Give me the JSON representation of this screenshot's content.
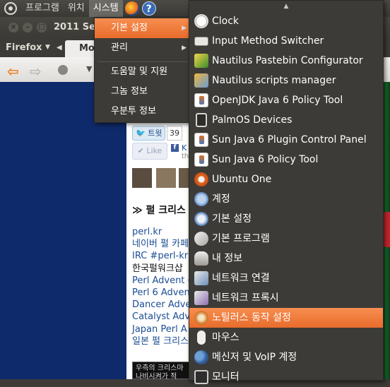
{
  "panel": {
    "menus": [
      "프로그램",
      "위치",
      "시스템"
    ],
    "active_menu": "시스템"
  },
  "browser": {
    "title": "2011 Se",
    "app_menu": "Firefox",
    "tab_label": "Mo",
    "tweet_label": "트윗",
    "tweet_count": "39",
    "like_label": "Like",
    "fb_name_frag": "K",
    "fb_sub_frag": "th",
    "section_title": "≫ 펄 크리스",
    "links": [
      "perl.kr",
      "네이버 펄 카페",
      "IRC #perl-kr",
      "한국펄워크샵",
      "Perl Advent (",
      "Perl 6 Adven",
      "Dancer Adve",
      "Catalyst Adv",
      "Japan Perl A",
      "일본 펄 크리스"
    ],
    "note_text": "우측의 크리스마 나비시켜가 적"
  },
  "system_menu": {
    "items": [
      {
        "label": "기본 설정",
        "has_submenu": true,
        "highlighted": true
      },
      {
        "label": "관리",
        "has_submenu": true,
        "highlighted": false
      },
      {
        "label": "도움말 및 지원",
        "has_submenu": false,
        "highlighted": false
      },
      {
        "label": "그놈 정보",
        "has_submenu": false,
        "highlighted": false
      },
      {
        "label": "우분투 정보",
        "has_submenu": false,
        "highlighted": false
      }
    ]
  },
  "preferences_submenu": {
    "scroll_up_arrow": "▲",
    "items": [
      {
        "label": "Clock",
        "icon": "clock-icon"
      },
      {
        "label": "Input Method Switcher",
        "icon": "keyboard-icon"
      },
      {
        "label": "Nautilus Pastebin Configurator",
        "icon": "pastebin-icon"
      },
      {
        "label": "Nautilus scripts manager",
        "icon": "scripts-icon"
      },
      {
        "label": "OpenJDK Java 6 Policy Tool",
        "icon": "java-icon"
      },
      {
        "label": "PalmOS Devices",
        "icon": "palm-device-icon"
      },
      {
        "label": "Sun Java 6 Plugin Control Panel",
        "icon": "java-icon"
      },
      {
        "label": "Sun Java 6 Policy Tool",
        "icon": "java-icon"
      },
      {
        "label": "Ubuntu One",
        "icon": "ubuntu-one-icon"
      },
      {
        "label": "계정",
        "icon": "accounts-icon"
      },
      {
        "label": "기본 설정",
        "icon": "preferences-icon"
      },
      {
        "label": "기본 프로그램",
        "icon": "default-apps-icon"
      },
      {
        "label": "내 정보",
        "icon": "about-me-icon"
      },
      {
        "label": "네트워크 연결",
        "icon": "network-connections-icon"
      },
      {
        "label": "네트워크 프록시",
        "icon": "network-proxy-icon"
      },
      {
        "label": "노틸러스 동작 설정",
        "icon": "nautilus-actions-icon",
        "highlighted": true
      },
      {
        "label": "마우스",
        "icon": "mouse-icon"
      },
      {
        "label": "메신저 및 VoIP 계정",
        "icon": "messenger-icon"
      },
      {
        "label": "모니터",
        "icon": "monitor-icon"
      }
    ]
  }
}
